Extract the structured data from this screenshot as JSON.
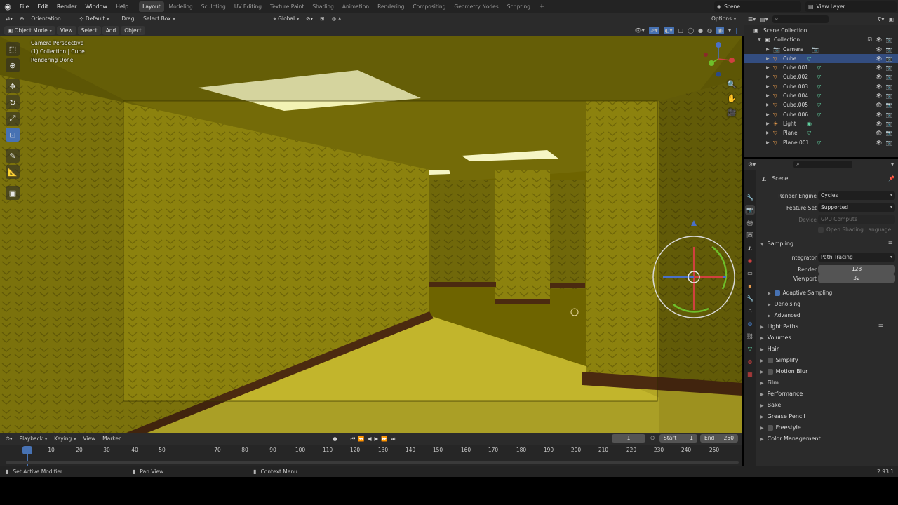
{
  "topbar": {
    "menus": [
      "File",
      "Edit",
      "Render",
      "Window",
      "Help"
    ],
    "workspaces": [
      "Layout",
      "Modeling",
      "Sculpting",
      "UV Editing",
      "Texture Paint",
      "Shading",
      "Animation",
      "Rendering",
      "Compositing",
      "Geometry Nodes",
      "Scripting"
    ],
    "active_workspace": "Layout",
    "scene": "Scene",
    "view_layer": "View Layer"
  },
  "toolheader": {
    "orientation_label": "Orientation:",
    "orientation_value": "Default",
    "drag_label": "Drag:",
    "drag_value": "Select Box",
    "transform_orientation": "Global",
    "options": "Options"
  },
  "viewheader": {
    "mode": "Object Mode",
    "menus": [
      "View",
      "Select",
      "Add",
      "Object"
    ]
  },
  "viewport": {
    "overlay_lines": [
      "Camera Perspective",
      "(1) Collection | Cube",
      "Rendering Done"
    ]
  },
  "outliner": {
    "root": "Scene Collection",
    "collection": "Collection",
    "items": [
      {
        "name": "Camera",
        "type": "camera"
      },
      {
        "name": "Cube",
        "type": "mesh",
        "selected": true
      },
      {
        "name": "Cube.001",
        "type": "mesh"
      },
      {
        "name": "Cube.002",
        "type": "mesh"
      },
      {
        "name": "Cube.003",
        "type": "mesh"
      },
      {
        "name": "Cube.004",
        "type": "mesh"
      },
      {
        "name": "Cube.005",
        "type": "mesh"
      },
      {
        "name": "Cube.006",
        "type": "mesh"
      },
      {
        "name": "Light",
        "type": "light"
      },
      {
        "name": "Plane",
        "type": "mesh"
      },
      {
        "name": "Plane.001",
        "type": "mesh"
      }
    ]
  },
  "properties": {
    "context": "Scene",
    "render_engine_label": "Render Engine",
    "render_engine": "Cycles",
    "feature_set_label": "Feature Set",
    "feature_set": "Supported",
    "device_label": "Device",
    "device": "GPU Compute",
    "osl": "Open Shading Language",
    "sampling": "Sampling",
    "integrator_label": "Integrator",
    "integrator": "Path Tracing",
    "render_label": "Render",
    "render_samples": "128",
    "viewport_label": "Viewport",
    "viewport_samples": "32",
    "adaptive_sampling": "Adaptive Sampling",
    "denoising": "Denoising",
    "advanced": "Advanced",
    "sections": [
      "Light Paths",
      "Volumes",
      "Hair",
      "Simplify",
      "Motion Blur",
      "Film",
      "Performance",
      "Bake",
      "Grease Pencil",
      "Freestyle",
      "Color Management"
    ]
  },
  "timeline": {
    "menus": [
      "Playback",
      "Keying",
      "View",
      "Marker"
    ],
    "current_frame": "1",
    "start_label": "Start",
    "start": "1",
    "end_label": "End",
    "end": "250",
    "ticks": [
      "1",
      "10",
      "20",
      "30",
      "40",
      "50",
      "70",
      "80",
      "90",
      "100",
      "110",
      "120",
      "130",
      "140",
      "150",
      "160",
      "170",
      "180",
      "190",
      "200",
      "210",
      "220",
      "230",
      "240",
      "250"
    ]
  },
  "statusbar": {
    "left": "Set Active Modifier",
    "middle": "Pan View",
    "right": "Context Menu",
    "version": "2.93.1"
  },
  "colors": {
    "accent": "#4772b3",
    "selected_row": "#334d80",
    "wall_yellow": "#8a7f0a"
  }
}
